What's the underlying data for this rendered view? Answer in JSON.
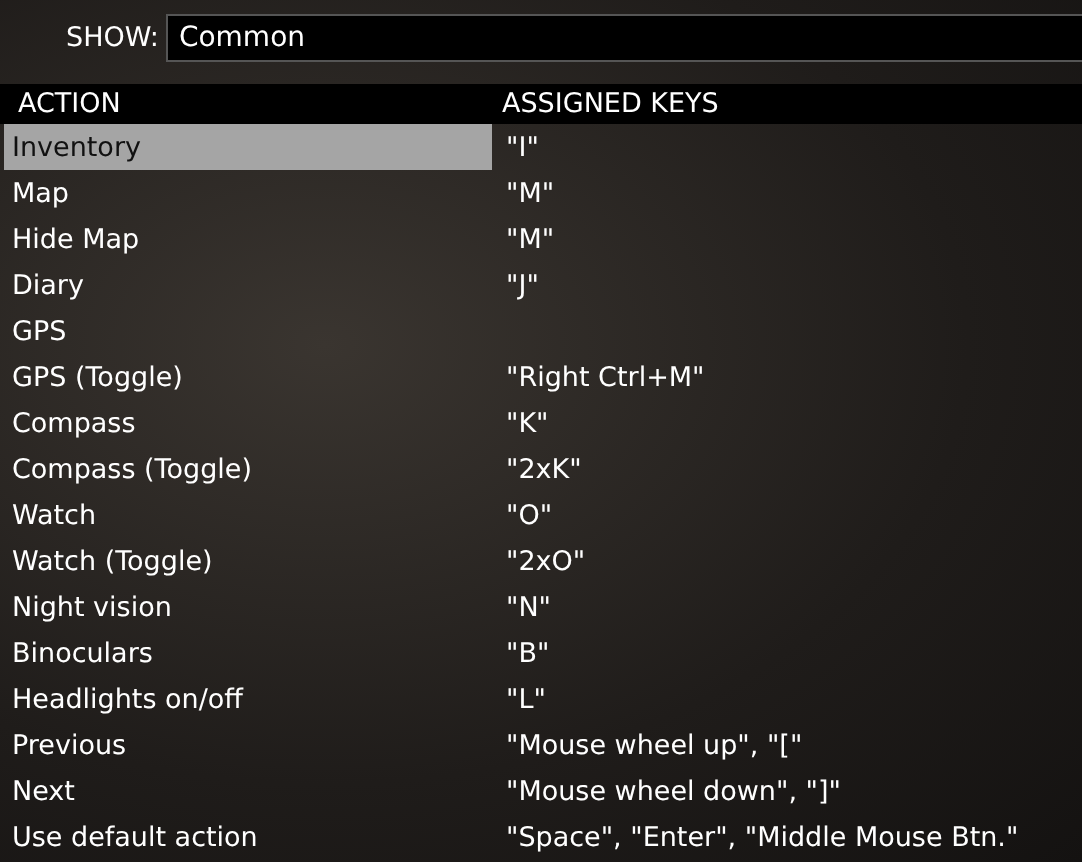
{
  "filter": {
    "label": "SHOW:",
    "value": "Common"
  },
  "table": {
    "columns": [
      "ACTION",
      "ASSIGNED KEYS"
    ],
    "rows": [
      {
        "action": "Inventory",
        "keys": "\"I\"",
        "selected": true
      },
      {
        "action": "Map",
        "keys": "\"M\"",
        "selected": false
      },
      {
        "action": "Hide Map",
        "keys": "\"M\"",
        "selected": false
      },
      {
        "action": "Diary",
        "keys": "\"J\"",
        "selected": false
      },
      {
        "action": "GPS",
        "keys": "",
        "selected": false
      },
      {
        "action": "GPS (Toggle)",
        "keys": "\"Right Ctrl+M\"",
        "selected": false
      },
      {
        "action": "Compass",
        "keys": "\"K\"",
        "selected": false
      },
      {
        "action": "Compass (Toggle)",
        "keys": "\"2xK\"",
        "selected": false
      },
      {
        "action": "Watch",
        "keys": "\"O\"",
        "selected": false
      },
      {
        "action": "Watch (Toggle)",
        "keys": "\"2xO\"",
        "selected": false
      },
      {
        "action": "Night vision",
        "keys": "\"N\"",
        "selected": false
      },
      {
        "action": "Binoculars",
        "keys": "\"B\"",
        "selected": false
      },
      {
        "action": "Headlights on/off",
        "keys": "\"L\"",
        "selected": false
      },
      {
        "action": "Previous",
        "keys": "\"Mouse wheel up\", \"[\"",
        "selected": false
      },
      {
        "action": "Next",
        "keys": "\"Mouse wheel down\", \"]\"",
        "selected": false
      },
      {
        "action": "Use default action",
        "keys": "\"Space\", \"Enter\", \"Middle Mouse Btn.\"",
        "selected": false
      }
    ]
  }
}
